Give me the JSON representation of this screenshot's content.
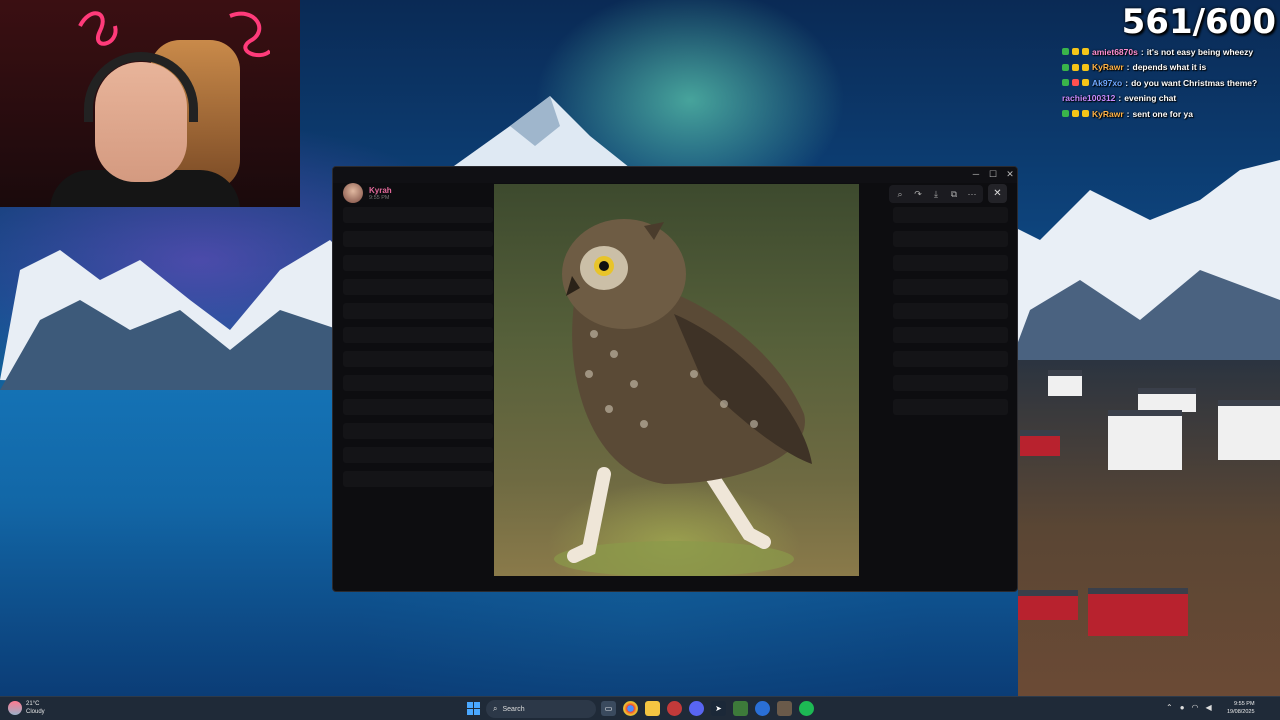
{
  "stream": {
    "counter": "561/600"
  },
  "chat": [
    {
      "user": "amiet6870s",
      "message": "it's not easy being wheezy",
      "color": "#ff8fd0",
      "badges": [
        "#3ab54a",
        "#f5c518",
        "#f5c518"
      ]
    },
    {
      "user": "KyRawr",
      "message": "depends what it is",
      "color": "#ffb347",
      "badges": [
        "#3ab54a",
        "#f5c518",
        "#f5c518"
      ]
    },
    {
      "user": "Ak97xo",
      "message": "do you want Christmas theme?",
      "color": "#6fa8ff",
      "badges": [
        "#3ab54a",
        "#ff5050",
        "#f5c518"
      ]
    },
    {
      "user": "rachie100312",
      "message": "evening chat",
      "color": "#c98bff",
      "badges": []
    },
    {
      "user": "KyRawr",
      "message": "sent one for ya",
      "color": "#ffb347",
      "badges": [
        "#3ab54a",
        "#f5c518",
        "#f5c518"
      ]
    }
  ],
  "viewer": {
    "author_name": "Kyrah",
    "author_time": "9:55 PM",
    "toolbar_icons": [
      "zoom-icon",
      "forward-icon",
      "download-icon",
      "open-external-icon",
      "more-icon"
    ],
    "close_icon": "close-icon"
  },
  "window": {
    "controls": [
      "minimize-icon",
      "maximize-icon",
      "close-icon"
    ]
  },
  "taskbar": {
    "weather_temp": "21°C",
    "weather_desc": "Cloudy",
    "search_placeholder": "Search",
    "time": "9:55 PM",
    "date": "19/08/2025"
  }
}
